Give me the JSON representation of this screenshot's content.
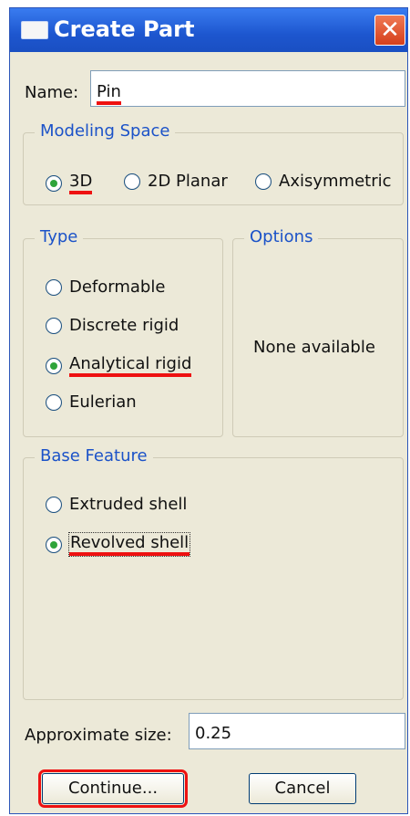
{
  "window": {
    "title": "Create Part",
    "close_glyph": "✕"
  },
  "name_field": {
    "label": "Name:",
    "value": "Pin"
  },
  "modeling_space": {
    "legend": "Modeling Space",
    "options": [
      {
        "label": "3D",
        "checked": true
      },
      {
        "label": "2D Planar",
        "checked": false
      },
      {
        "label": "Axisymmetric",
        "checked": false
      }
    ]
  },
  "type": {
    "legend": "Type",
    "options": [
      {
        "label": "Deformable",
        "checked": false
      },
      {
        "label": "Discrete rigid",
        "checked": false
      },
      {
        "label": "Analytical rigid",
        "checked": true
      },
      {
        "label": "Eulerian",
        "checked": false
      }
    ]
  },
  "options_panel": {
    "legend": "Options",
    "text": "None available"
  },
  "base_feature": {
    "legend": "Base Feature",
    "options": [
      {
        "label": "Extruded shell",
        "checked": false
      },
      {
        "label": "Revolved shell",
        "checked": true
      }
    ]
  },
  "approx_size": {
    "label": "Approximate size:",
    "value": "0.25"
  },
  "buttons": {
    "continue": "Continue...",
    "cancel": "Cancel"
  },
  "colors": {
    "title_bar": "#1d56cf",
    "group_label": "#1b52c8",
    "highlight": "#e11111"
  }
}
